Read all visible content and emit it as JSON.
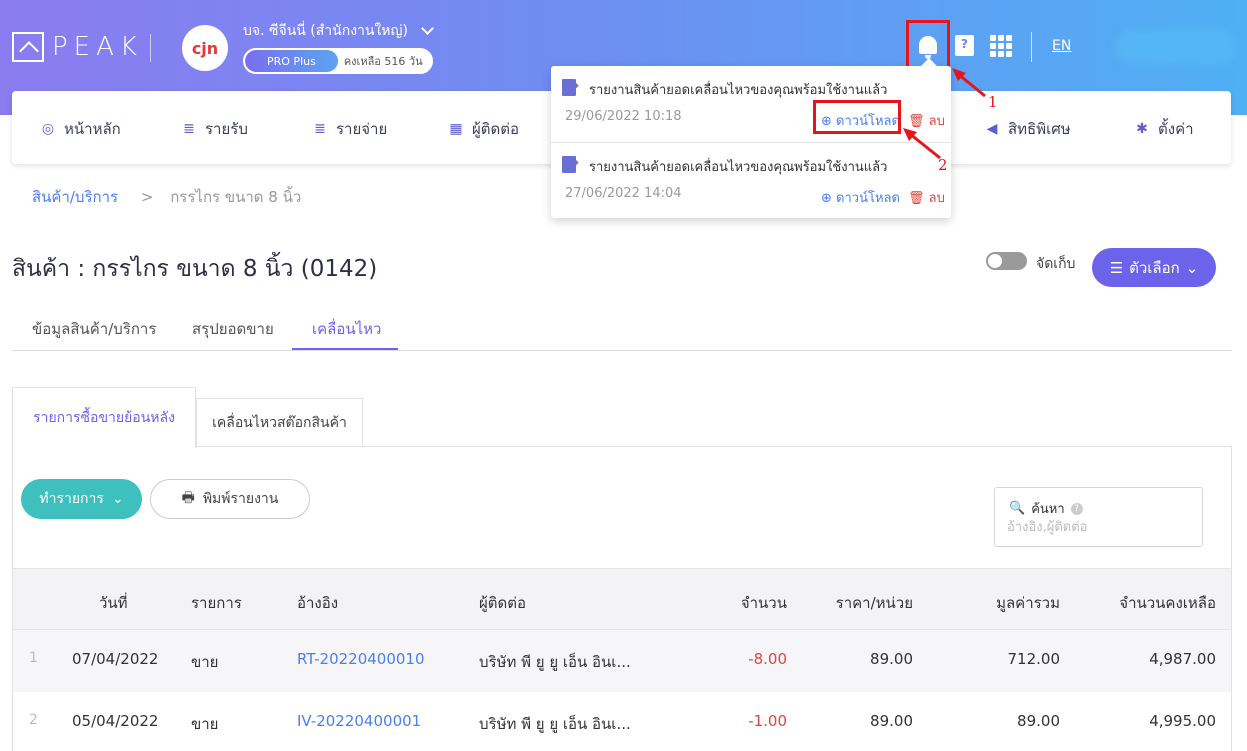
{
  "header": {
    "logo_text": "PEAK",
    "company_avatar_text": "cjn",
    "company_name": "บจ. ซีจีนนี่ (สำนักงานใหญ่)",
    "plan_badge": "PRO Plus",
    "plan_remaining": "คงเหลือ 516 วัน",
    "language": "EN"
  },
  "nav": {
    "items": [
      {
        "label": "หน้าหลัก",
        "icon": "dashboard-icon"
      },
      {
        "label": "รายรับ",
        "icon": "income-icon"
      },
      {
        "label": "รายจ่าย",
        "icon": "expense-icon"
      },
      {
        "label": "ผู้ติดต่อ",
        "icon": "contacts-icon"
      },
      {
        "label": "สิทธิพิเศษ",
        "icon": "megaphone-icon"
      },
      {
        "label": "ตั้งค่า",
        "icon": "gear-icon"
      }
    ]
  },
  "notifications": [
    {
      "title": "รายงานสินค้ายอดเคลื่อนไหวของคุณพร้อมใช้งานแล้ว",
      "time": "29/06/2022 10:18",
      "download": "ดาวน์โหลด",
      "delete": "ลบ"
    },
    {
      "title": "รายงานสินค้ายอดเคลื่อนไหวของคุณพร้อมใช้งานแล้ว",
      "time": "27/06/2022 14:04",
      "download": "ดาวน์โหลด",
      "delete": "ลบ"
    }
  ],
  "annotations": {
    "one": "1",
    "two": "2"
  },
  "breadcrumb": {
    "parent": "สินค้า/บริการ",
    "separator": ">",
    "current": "กรรไกร ขนาด 8 นิ้ว"
  },
  "page": {
    "title": "สินค้า : กรรไกร ขนาด 8 นิ้ว (0142)",
    "archive_label": "จัดเก็บ",
    "options_label": "ตัวเลือก"
  },
  "tabs": [
    "ข้อมูลสินค้า/บริการ",
    "สรุปยอดขาย",
    "เคลื่อนไหว"
  ],
  "subtabs": [
    "รายการซื้อขายย้อนหลัง",
    "เคลื่อนไหวสต๊อกสินค้า"
  ],
  "toolbar": {
    "action_label": "ทำรายการ",
    "print_label": "พิมพ์รายงาน"
  },
  "search": {
    "label": "ค้นหา",
    "placeholder": "อ้างอิง,ผู้ติดต่อ"
  },
  "table": {
    "headers": [
      "วันที่",
      "รายการ",
      "อ้างอิง",
      "ผู้ติดต่อ",
      "จำนวน",
      "ราคา/หน่วย",
      "มูลค่ารวม",
      "จำนวนคงเหลือ"
    ],
    "rows": [
      {
        "index": "1",
        "date": "07/04/2022",
        "type": "ขาย",
        "ref": "RT-20220400010",
        "contact": "บริษัท พี ยู ยู เอ็น อินเ...",
        "qty": "-8.00",
        "unit_price": "89.00",
        "total": "712.00",
        "balance": "4,987.00"
      },
      {
        "index": "2",
        "date": "05/04/2022",
        "type": "ขาย",
        "ref": "IV-20220400001",
        "contact": "บริษัท พี ยู ยู เอ็น อินเ...",
        "qty": "-1.00",
        "unit_price": "89.00",
        "total": "89.00",
        "balance": "4,995.00"
      }
    ]
  },
  "colors": {
    "accent": "#6b63ea",
    "teal": "#3ec0bf",
    "link": "#4a7ff0",
    "negative": "#e0443a",
    "annotation": "#e8141b"
  }
}
